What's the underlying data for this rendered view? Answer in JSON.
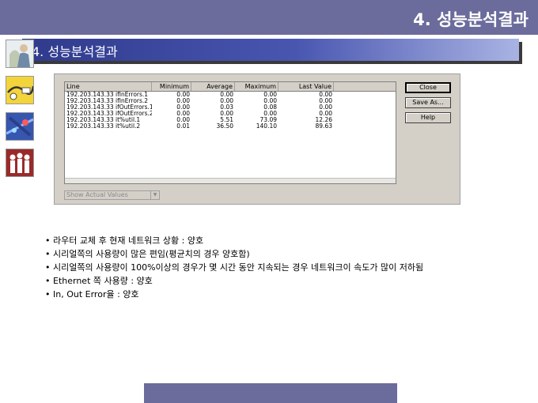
{
  "header": {
    "title": "4. 성능분석결과"
  },
  "section": {
    "title": "4.  성능분석결과"
  },
  "thumbnails": [
    {
      "icon": "people-photo-icon"
    },
    {
      "icon": "network-cable-icon"
    },
    {
      "icon": "blue-network-icon"
    },
    {
      "icon": "people-group-icon"
    }
  ],
  "dialog": {
    "columns": [
      "Line",
      "Minimum",
      "Average",
      "Maximum",
      "Last Value"
    ],
    "rows": [
      [
        "192.203.143.33 ifInErrors.1",
        "0.00",
        "0.00",
        "0.00",
        "0.00"
      ],
      [
        "192.203.143.33 ifInErrors.2",
        "0.00",
        "0.00",
        "0.00",
        "0.00"
      ],
      [
        "192.203.143.33 ifOutErrors.1",
        "0.00",
        "0.03",
        "0.08",
        "0.00"
      ],
      [
        "192.203.143.33 ifOutErrors.2",
        "0.00",
        "0.00",
        "0.00",
        "0.00"
      ],
      [
        "192.203.143.33 it%util.1",
        "0.00",
        "5.51",
        "73.09",
        "12.26"
      ],
      [
        "192.203.143.33 it%util.2",
        "0.01",
        "36.50",
        "140.10",
        "89.63"
      ]
    ],
    "buttons": {
      "close": "Close",
      "save_as": "Save As...",
      "help": "Help"
    },
    "select": {
      "value": "Show Actual Values"
    }
  },
  "bullets": [
    "라우터 교체 후 현재 네트워크 상황 : 양호",
    "시리얼쪽의 사용량이 많은 편임(평균치의 경우 양호함)",
    "시리얼쪽의 사용량이 100%이상의 경우가 몇 시간 동안 지속되는 경우 네트워크이 속도가 많이 저하됨",
    "Ethernet 쪽 사용량 : 양호",
    "In, Out Error율 : 양호"
  ],
  "colors": {
    "header": "#6b6b9c",
    "banner": "#3d4aa0"
  }
}
